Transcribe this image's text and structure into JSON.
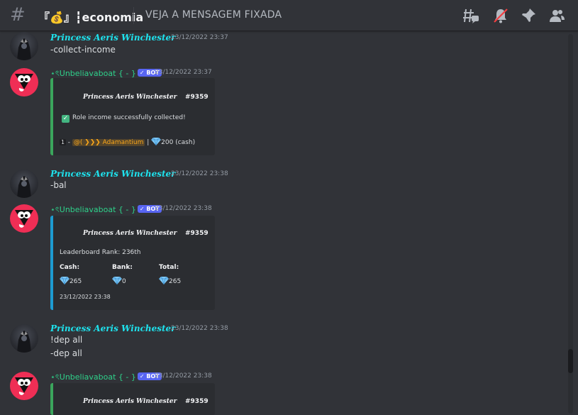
{
  "header": {
    "channel_name": "『💰』┇economia",
    "topic": "VEJA A MENSAGEM FIXADA"
  },
  "icons": {
    "hash": "hashtag-icon",
    "threads": "threads-icon",
    "mute": "bell-muted-icon",
    "pin": "pin-icon",
    "members": "members-icon"
  },
  "colors": {
    "background": "#313338",
    "username": "#1ee3ee",
    "botname": "#2ed18a",
    "bot_tag": "#5865f2",
    "embed_green": "#3ba55c",
    "embed_blue": "#1d9bd1",
    "avatar_bot": "#ef2e55"
  },
  "messages": [
    {
      "author": "Princess Aeris Winchester",
      "timestamp": "23/12/2022 23:37",
      "lines": [
        "-collect-income"
      ]
    },
    {
      "author": "⋆ৎUnbeliavaboat { - }",
      "bot_tag": "✓ BOT",
      "timestamp": "23/12/2022 23:37",
      "embed": {
        "author": "Princess Aeris Winchester",
        "id": "#9359",
        "line1": "Role income successfully collected!",
        "role_line": {
          "prefix": "1",
          "dash": " - ",
          "mention": "@(  ❯❯❯ Adamantium",
          "sep": " | ",
          "amount": "200 (cash)"
        }
      }
    },
    {
      "author": "Princess Aeris Winchester",
      "timestamp": "23/12/2022 23:38",
      "lines": [
        "-bal"
      ]
    },
    {
      "author": "⋆ৎUnbeliavaboat { - }",
      "bot_tag": "✓ BOT",
      "timestamp": "23/12/2022 23:38",
      "embed": {
        "author": "Princess Aeris Winchester",
        "id": "#9359",
        "rank": "Leaderboard Rank: 236th",
        "fields": [
          {
            "label": "Cash:",
            "value": "265"
          },
          {
            "label": "Bank:",
            "value": "0"
          },
          {
            "label": "Total:",
            "value": "265"
          }
        ],
        "footer": "23/12/2022 23:38"
      }
    },
    {
      "author": "Princess Aeris Winchester",
      "timestamp": "23/12/2022 23:38",
      "lines": [
        "!dep all",
        "-dep all"
      ]
    },
    {
      "author": "⋆ৎUnbeliavaboat { - }",
      "bot_tag": "✓ BOT",
      "timestamp": "23/12/2022 23:38",
      "embed": {
        "author": "Princess Aeris Winchester",
        "id": "#9359"
      }
    }
  ]
}
